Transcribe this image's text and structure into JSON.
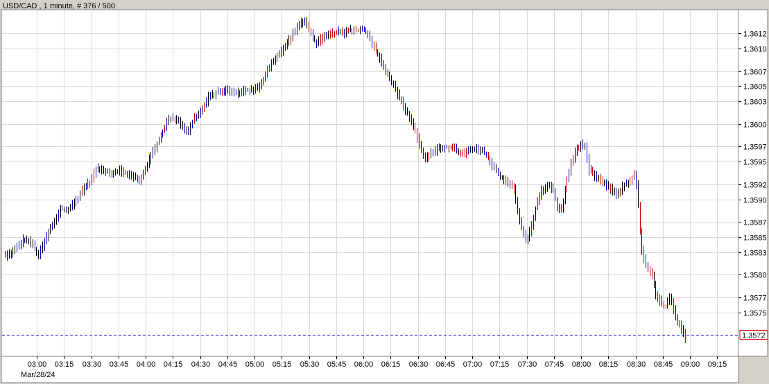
{
  "chart_data": {
    "type": "ohlc",
    "title": "USD/CAD , 1 minute, # 376 / 500",
    "date_label": "Mar/28/24",
    "x_ticks": [
      "03:00",
      "03:15",
      "03:30",
      "03:45",
      "04:00",
      "04:15",
      "04:30",
      "04:45",
      "05:00",
      "05:15",
      "05:30",
      "05:45",
      "06:00",
      "06:15",
      "06:30",
      "06:45",
      "07:00",
      "07:15",
      "07:30",
      "07:45",
      "08:00",
      "08:15",
      "08:30",
      "08:45",
      "09:00",
      "09:15"
    ],
    "y_ticks": [
      "1.3612",
      "1.3610",
      "1.3607",
      "1.3605",
      "1.3603",
      "1.3600",
      "1.3597",
      "1.3595",
      "1.3592",
      "1.3590",
      "1.3587",
      "1.3585",
      "1.3583",
      "1.3580",
      "1.3577",
      "1.3575"
    ],
    "ylim": [
      1.35712,
      1.36135
    ],
    "grid": true,
    "current_price": {
      "label": "1.3572",
      "value": 1.3572,
      "color": "#0000cc"
    },
    "colors": {
      "up": "#0000cc",
      "down": "#cc0000",
      "neutral": "#000000",
      "background": "#ffffff",
      "grid": "#d9d9d9"
    },
    "bar_colors": "bkkbkkbbkkbkkkkbkkbkbbkkbkkbkbkbkkbkbbkrkbrrbrbkbkkbkbkbkbbkrrbkbbkrkbkrkbkbkkbbbrbkkbrkbkkbkbkbrbkbkrbkbkbkbbrbkkbkbbkbrkbkbbkbkbkkbrrbkbkkbkbbkrkbkkbkbkrrbkbkrrkbkrrrrbkrbkrkbkrrkbbkbkbrrbkbbkkbkkbkkbrkkbbkrrbkbbkrkbkkbkkbbkkrrbkrrrrbkkbkbkkbbrbkbkbkkkrkbrrkbkbkbkkrbkrbkbkkbrkbkkrkkrbkrkbrkbkbbbrkbkrrkbkrkkbkrkkbkrrrbkrkrbkrrkkrrkrrbkkrkkrrkr"
  }
}
